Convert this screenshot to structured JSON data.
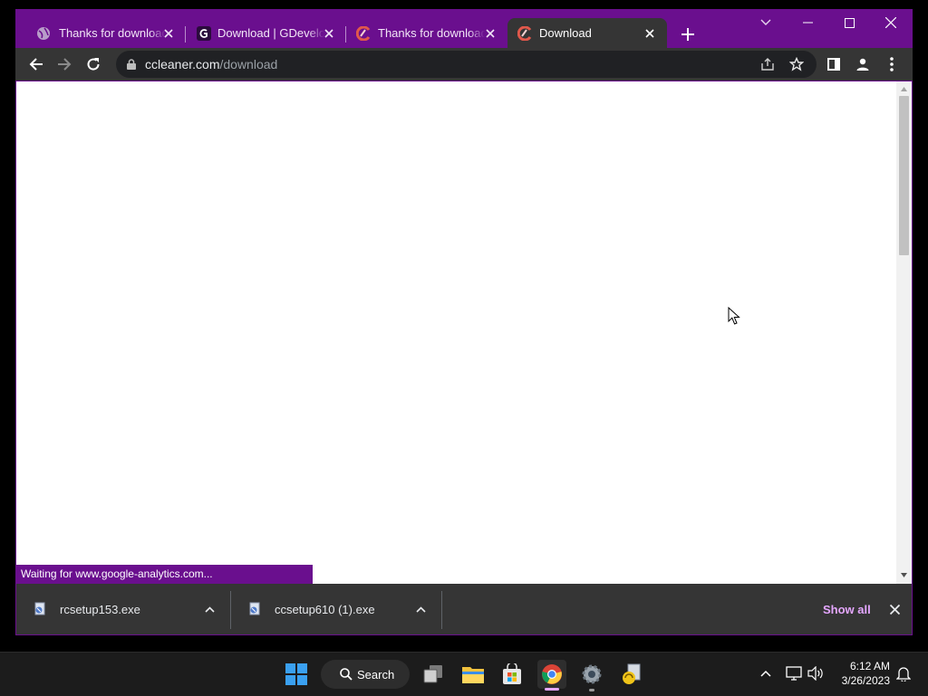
{
  "browser": {
    "tabs": [
      {
        "title": "Thanks for downloading",
        "favicon": "globe-icon",
        "active": false
      },
      {
        "title": "Download | GDevelop",
        "favicon": "gdevelop-icon",
        "active": false
      },
      {
        "title": "Thanks for downloading",
        "favicon": "ccleaner-icon",
        "active": false
      },
      {
        "title": "Download",
        "favicon": "ccleaner-icon",
        "active": true
      }
    ],
    "address": {
      "domain": "ccleaner.com",
      "path": "/download"
    },
    "status_text": "Waiting for www.google-analytics.com...",
    "frame_color": "#6a0f8e",
    "accent_color": "#e5a7ff"
  },
  "downloads": {
    "items": [
      {
        "filename": "rcsetup153.exe"
      },
      {
        "filename": "ccsetup610 (1).exe"
      }
    ],
    "show_all_label": "Show all"
  },
  "taskbar": {
    "search_label": "Search",
    "clock": {
      "time": "6:12 AM",
      "date": "3/26/2023"
    },
    "apps": [
      "windows-start-icon",
      "search-icon",
      "task-view-icon",
      "file-explorer-icon",
      "microsoft-store-icon",
      "chrome-icon",
      "settings-icon",
      "ccleaner-setup-icon"
    ]
  }
}
